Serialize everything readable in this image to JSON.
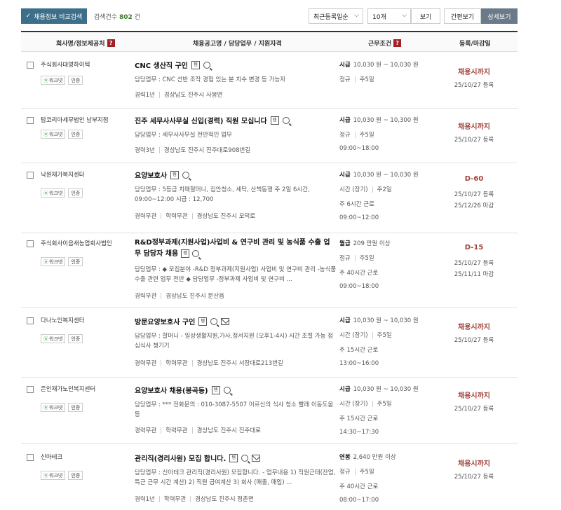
{
  "toolbar": {
    "compare_label": "채용정보 비교검색",
    "count_label": "검색건수",
    "count_value": "802",
    "count_unit": "건",
    "sort_selected": "최근등록일순",
    "per_page_selected": "10개",
    "view_label": "보기",
    "simple_view_label": "간편보기",
    "detail_view_label": "상세보기"
  },
  "header": {
    "company": "회사명/정보제공처",
    "title": "채용공고명 / 담당업무 / 지원자격",
    "conditions": "근무조건",
    "deadline": "등록/마감일"
  },
  "icons": {
    "question": "?",
    "doc": "템",
    "checkmark": "✓",
    "dropdown": "⌵",
    "leaf": "ⓦ"
  },
  "rows": [
    {
      "company": "주식회사대영하이텍",
      "source": "워크넷",
      "cert": "인증",
      "title": "CNC 생산직 구인",
      "duty": "담당업무 : CNC 선반 조작 경험 있는 분 치수 변경 등 가능자",
      "career": "경력1년",
      "location": "경상남도 진주시 사봉면",
      "pay_type": "시급",
      "pay": "10,030 원 ~ 10,030 원",
      "emp_type": "정규",
      "work_days": "주5일",
      "hours": "",
      "time": "",
      "deadline": "채용시까지",
      "registered": "25/10/27 등록",
      "closing": ""
    },
    {
      "company": "탑코리아세무법인 남부지점",
      "source": "워크넷",
      "cert": "인증",
      "title": "진주 세무사사무실 신입(경력) 직원 모십니다",
      "duty": "담당업무 : 세무사사무실 전반적인 업무",
      "career": "경력3년",
      "location": "경상남도 진주시 진주대로908번길",
      "pay_type": "시급",
      "pay": "10,030 원 ~ 10,300 원",
      "emp_type": "정규",
      "work_days": "주5일",
      "hours": "",
      "time": "09:00~18:00",
      "deadline": "채용시까지",
      "registered": "25/10/27 등록",
      "closing": ""
    },
    {
      "company": "낙원재가복지센터",
      "source": "워크넷",
      "cert": "인증",
      "title": "요양보호사",
      "duty": "담당업무 : 5등급 치매할머니, 집안청소, 세탁, 산책동행 주 2일 6시간, 09:00~12:00 시급 : 12,700",
      "career": "경력무관",
      "education": "학력무관",
      "location": "경상남도 진주시 모덕로",
      "pay_type": "시급",
      "pay": "10,030 원 ~ 10,030 원",
      "emp_type": "시간 (장기)",
      "work_days": "주2일",
      "hours": "주 6시간 근로",
      "time": "09:00~12:00",
      "deadline": "D-60",
      "registered": "25/10/27 등록",
      "closing": "25/12/26 마감"
    },
    {
      "company": "주식회사이음새농업회사법인",
      "source": "워크넷",
      "cert": "인증",
      "title": "R&D정부과제(지원사업)사업비 & 연구비 관리 및 농식품 수출 업무 담당자 채용",
      "duty": "담당업무 : ◆ 모집분야 -R&D 정부과제(지원사업) 사업비 및 연구비 관리 -농식품 수출 관련 업무 전반 ◆ 담당업무 -정부과제 사업비 및 연구비 ...",
      "career": "경력무관",
      "location": "경상남도 진주시 문산읍",
      "pay_type": "월급",
      "pay": "209 만원 이상",
      "emp_type": "정규",
      "work_days": "주5일",
      "hours": "주 40시간 근로",
      "time": "09:00~18:00",
      "deadline": "D-15",
      "registered": "25/10/27 등록",
      "closing": "25/11/11 마감"
    },
    {
      "company": "다나노인복지센터",
      "source": "워크넷",
      "cert": "인증",
      "title": "방문요양보호사 구인",
      "duty": "담당업무 : 할머니 - 일상생활지원,가사,정서지원 (오후1-4시) 시간 조절 가능 점심식사 챙기기",
      "career": "경력무관",
      "education": "학력무관",
      "location": "경상남도 진주시 서장대로213번길",
      "pay_type": "시급",
      "pay": "10,030 원 ~ 10,030 원",
      "emp_type": "시간 (장기)",
      "work_days": "주5일",
      "hours": "주 15시간 근로",
      "time": "13:00~16:00",
      "deadline": "채용시까지",
      "registered": "25/10/27 등록",
      "closing": ""
    },
    {
      "company": "은인재가노인복지센터",
      "source": "워크넷",
      "cert": "인증",
      "title": "요양보호사 채용(봉곡동)",
      "duty": "담당업무 : *** 전화문의 : 010-3087-5507 어르신의 식사 청소 빨래 이동도움 등",
      "career": "경력무관",
      "education": "학력무관",
      "location": "경상남도 진주시 진주대로",
      "pay_type": "시급",
      "pay": "10,030 원 ~ 10,030 원",
      "emp_type": "시간 (장기)",
      "work_days": "주5일",
      "hours": "주 15시간 근로",
      "time": "14:30~17:30",
      "deadline": "채용시까지",
      "registered": "25/10/27 등록",
      "closing": ""
    },
    {
      "company": "신아테크",
      "source": "워크넷",
      "cert": "인증",
      "title": "관리직(경리사원) 모집 합니다.",
      "duty": "담당업무 : 신아테크 관리직(경리사원) 모집합니다. - 업무내용 1) 직원근태(잔업, 특근 근무 시간 계산) 2) 직원 급여계산 3) 회사 (매출, 매입) ...",
      "career": "경력1년",
      "education": "학력무관",
      "location": "경상남도 진주시 정촌면",
      "pay_type": "연봉",
      "pay": "2,640 만원 이상",
      "emp_type": "정규",
      "work_days": "주5일",
      "hours": "주 40시간 근로",
      "time": "08:00~17:00",
      "deadline": "채용시까지",
      "registered": "25/10/27 등록",
      "closing": ""
    }
  ]
}
